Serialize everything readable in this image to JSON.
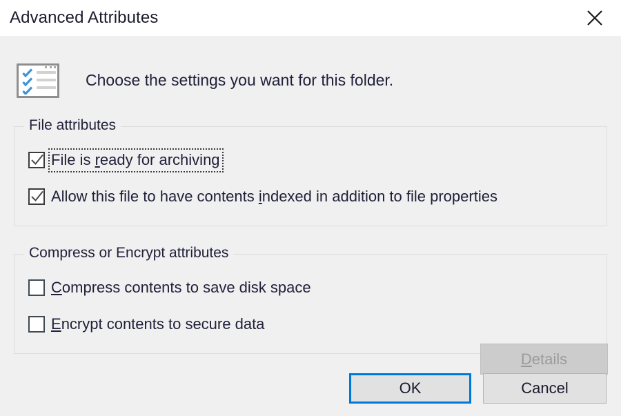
{
  "window": {
    "title": "Advanced Attributes",
    "close_icon": "close-icon",
    "titlebar_bg": "#ffffff",
    "body_bg": "#f0f0f0"
  },
  "header": {
    "icon": "attributes-checklist-icon",
    "prompt": "Choose the settings you want for this folder."
  },
  "groups": [
    {
      "id": "file-attributes",
      "label": "File attributes",
      "checkboxes": [
        {
          "id": "archive-ready",
          "label_before": "File is ",
          "accelerator": "r",
          "label_after": "eady for archiving",
          "checked": true,
          "focused": true
        },
        {
          "id": "allow-indexing",
          "label_before": "Allow this file to have contents ",
          "accelerator": "i",
          "label_after": "ndexed in addition to file properties",
          "checked": true,
          "focused": false
        }
      ]
    },
    {
      "id": "compress-encrypt-attributes",
      "label": "Compress or Encrypt attributes",
      "checkboxes": [
        {
          "id": "compress-contents",
          "label_before": "",
          "accelerator": "C",
          "label_after": "ompress contents to save disk space",
          "checked": false,
          "focused": false
        },
        {
          "id": "encrypt-contents",
          "label_before": "",
          "accelerator": "E",
          "label_after": "ncrypt contents to secure data",
          "checked": false,
          "focused": false
        }
      ],
      "details_button": {
        "label_accelerator": "D",
        "label_rest": "etails",
        "enabled": false
      }
    }
  ],
  "footer": {
    "ok_label": "OK",
    "cancel_label": "Cancel",
    "default_button": "OK",
    "accent_color": "#0078d7"
  }
}
